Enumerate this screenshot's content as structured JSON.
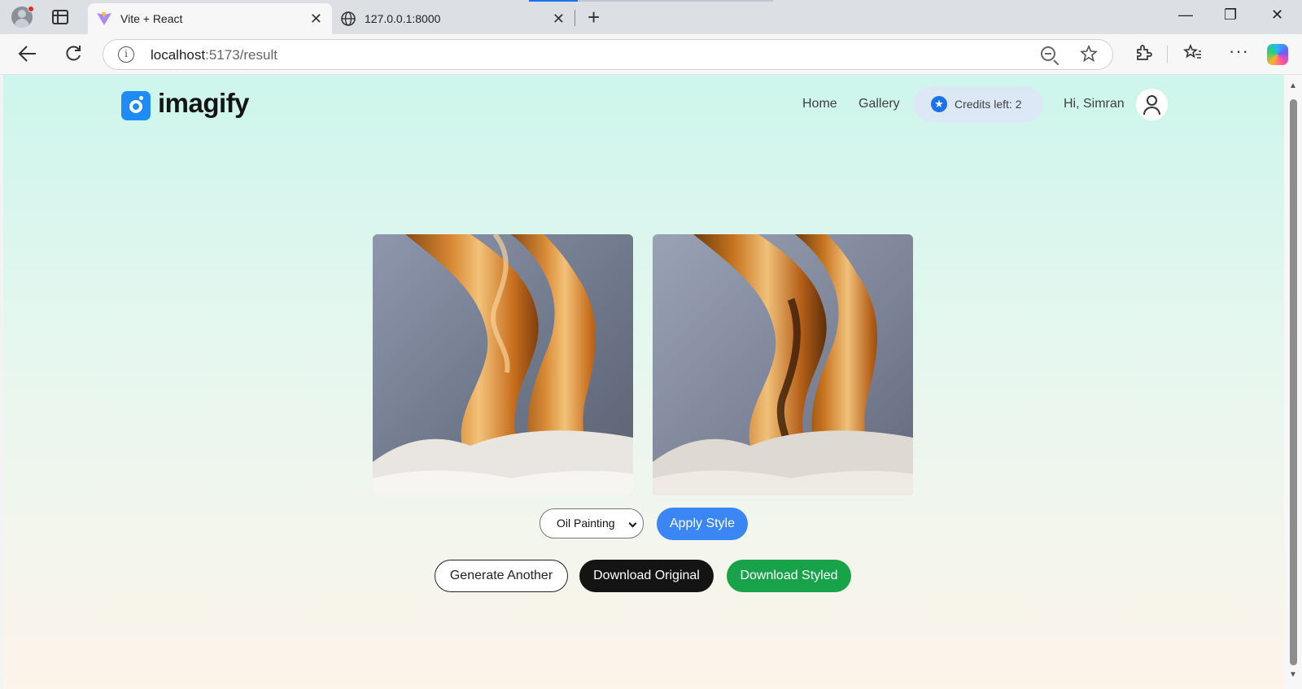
{
  "browser": {
    "tabs": [
      {
        "title": "Vite + React",
        "active": true
      },
      {
        "title": "127.0.0.1:8000",
        "active": false
      }
    ],
    "url_host": "localhost",
    "url_path": ":5173/result",
    "info_icon": "i",
    "close_glyph": "✕",
    "newtab_glyph": "+",
    "window_controls": {
      "minimize": "—",
      "restore": "❐",
      "close": "✕"
    }
  },
  "header": {
    "logo_text": "imagify",
    "nav": {
      "home": "Home",
      "gallery": "Gallery"
    },
    "credits": "Credits left: 2",
    "greeting": "Hi, Simran"
  },
  "result": {
    "style_select": {
      "value": "Oil Painting"
    },
    "apply_label": "Apply Style",
    "generate_label": "Generate Another",
    "download_original_label": "Download Original",
    "download_styled_label": "Download Styled"
  },
  "colors": {
    "accent_blue": "#3a86f5",
    "download_green": "#18a24a",
    "dark_button": "#141414",
    "page_gradient_top": "#cdf6ec",
    "page_gradient_bottom": "#fdf4ea"
  }
}
